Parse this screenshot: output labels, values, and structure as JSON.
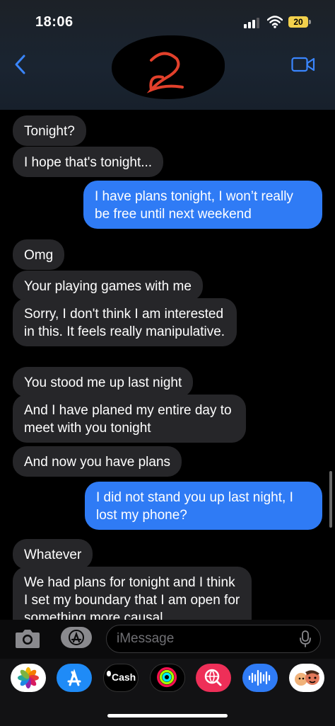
{
  "status_bar": {
    "time": "18:06",
    "battery": "20"
  },
  "header": {
    "back_icon": "chevron-left-icon",
    "video_icon": "video-camera-icon",
    "contact": "redacted"
  },
  "messages": [
    {
      "dir": "in",
      "text": "Tonight?"
    },
    {
      "dir": "in",
      "text": "I hope that's tonight..."
    },
    {
      "dir": "out",
      "text": "I have plans tonight, I won’t really be free until next weekend"
    },
    {
      "dir": "in",
      "text": "Omg"
    },
    {
      "dir": "in",
      "text": "Your playing games with me"
    },
    {
      "dir": "in",
      "text": "Sorry, I don't think I am interested in this. It feels really manipulative."
    },
    {
      "dir": "in",
      "text": "You stood me up last night"
    },
    {
      "dir": "in",
      "text": "And I have planed my entire day to meet with you tonight"
    },
    {
      "dir": "in",
      "text": "And now you have plans"
    },
    {
      "dir": "out",
      "text": "I did not stand you up last night, I lost my phone?"
    },
    {
      "dir": "in",
      "text": "Whatever"
    },
    {
      "dir": "in",
      "text": "We had plans for tonight and I think I set my boundary that I am open for something more causal"
    }
  ],
  "input": {
    "placeholder": "iMessage"
  },
  "drawer": {
    "apps": [
      {
        "name": "photos-app-icon"
      },
      {
        "name": "app-store-icon"
      },
      {
        "name": "apple-cash-icon",
        "label": "Cash"
      },
      {
        "name": "fitness-activity-icon"
      },
      {
        "name": "web-search-icon"
      },
      {
        "name": "audio-message-icon"
      },
      {
        "name": "memoji-icon"
      }
    ]
  }
}
